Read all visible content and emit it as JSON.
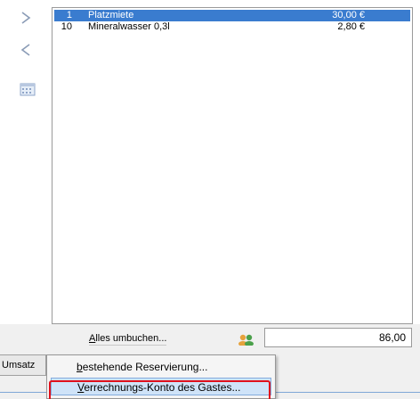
{
  "sidebar": {
    "icons": [
      "chevron-right-icon",
      "chevron-left-icon",
      "calendar-icon"
    ]
  },
  "items": [
    {
      "qty": "1",
      "name": "Platzmiete",
      "price": "30,00 €",
      "selected": true
    },
    {
      "qty": "10",
      "name": "Mineralwasser 0,3l",
      "price": "2,80 €",
      "selected": false
    }
  ],
  "footer": {
    "move_all_label": "Alles umbuchen...",
    "total": "86,00",
    "tab_label": "Umsatz"
  },
  "context_menu": {
    "items": [
      {
        "label": "bestehende Reservierung...",
        "accel": "b"
      },
      {
        "label": "Verrechnungs-Konto des Gastes...",
        "accel": "V"
      }
    ]
  },
  "colors": {
    "selection": "#3a7ccf",
    "menu_hover": "#cfe3f8",
    "annotation_red": "#e0101c"
  }
}
